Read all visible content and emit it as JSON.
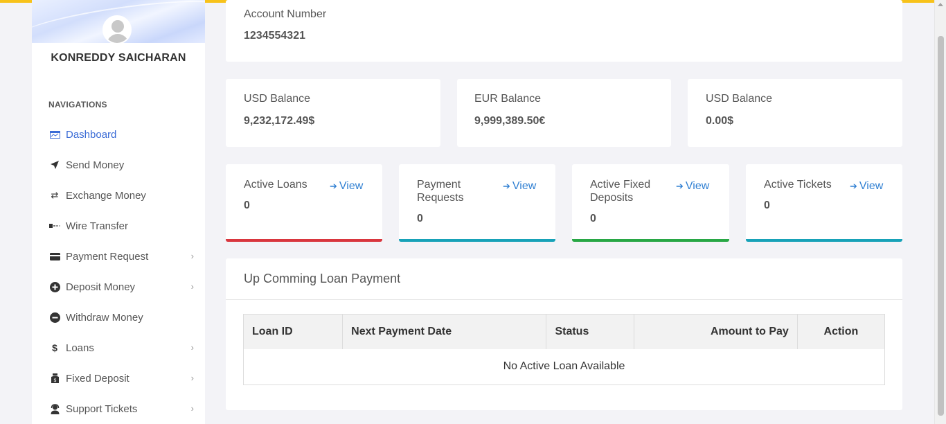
{
  "sidebar": {
    "user_name": "KONREDDY SAICHARAN",
    "nav_heading": "NAVIGATIONS",
    "items": [
      {
        "label": "Dashboard",
        "icon": "dashboard-icon",
        "active": true,
        "has_submenu": false
      },
      {
        "label": "Send Money",
        "icon": "send-icon",
        "active": false,
        "has_submenu": false
      },
      {
        "label": "Exchange Money",
        "icon": "exchange-icon",
        "active": false,
        "has_submenu": false
      },
      {
        "label": "Wire Transfer",
        "icon": "bank-icon",
        "active": false,
        "has_submenu": false
      },
      {
        "label": "Payment Request",
        "icon": "credit-card-icon",
        "active": false,
        "has_submenu": true
      },
      {
        "label": "Deposit Money",
        "icon": "plus-circle-icon",
        "active": false,
        "has_submenu": true
      },
      {
        "label": "Withdraw Money",
        "icon": "minus-circle-icon",
        "active": false,
        "has_submenu": false
      },
      {
        "label": "Loans",
        "icon": "dollar-icon",
        "active": false,
        "has_submenu": true
      },
      {
        "label": "Fixed Deposit",
        "icon": "money-bag-icon",
        "active": false,
        "has_submenu": true
      },
      {
        "label": "Support Tickets",
        "icon": "support-agent-icon",
        "active": false,
        "has_submenu": true
      }
    ]
  },
  "account": {
    "label": "Account Number",
    "number": "1234554321"
  },
  "balances": [
    {
      "label": "USD Balance",
      "value": "9,232,172.49$"
    },
    {
      "label": "EUR Balance",
      "value": "9,999,389.50€"
    },
    {
      "label": "USD Balance",
      "value": "0.00$"
    }
  ],
  "stats": [
    {
      "label": "Active Loans",
      "value": "0",
      "link": "View",
      "accent": "#d9363e"
    },
    {
      "label": "Payment Requests",
      "value": "0",
      "link": "View",
      "accent": "#17a2b8"
    },
    {
      "label": "Active Fixed Deposits",
      "value": "0",
      "link": "View",
      "accent": "#28a745"
    },
    {
      "label": "Active Tickets",
      "value": "0",
      "link": "View",
      "accent": "#17a2b8"
    }
  ],
  "loans_panel": {
    "title": "Up Comming Loan Payment",
    "columns": [
      "Loan ID",
      "Next Payment Date",
      "Status",
      "Amount to Pay",
      "Action"
    ],
    "empty_message": "No Active Loan Available"
  },
  "colors": {
    "top_bar": "#f7c21a",
    "link": "#2f7fd2",
    "active_nav": "#3a6bd6"
  }
}
